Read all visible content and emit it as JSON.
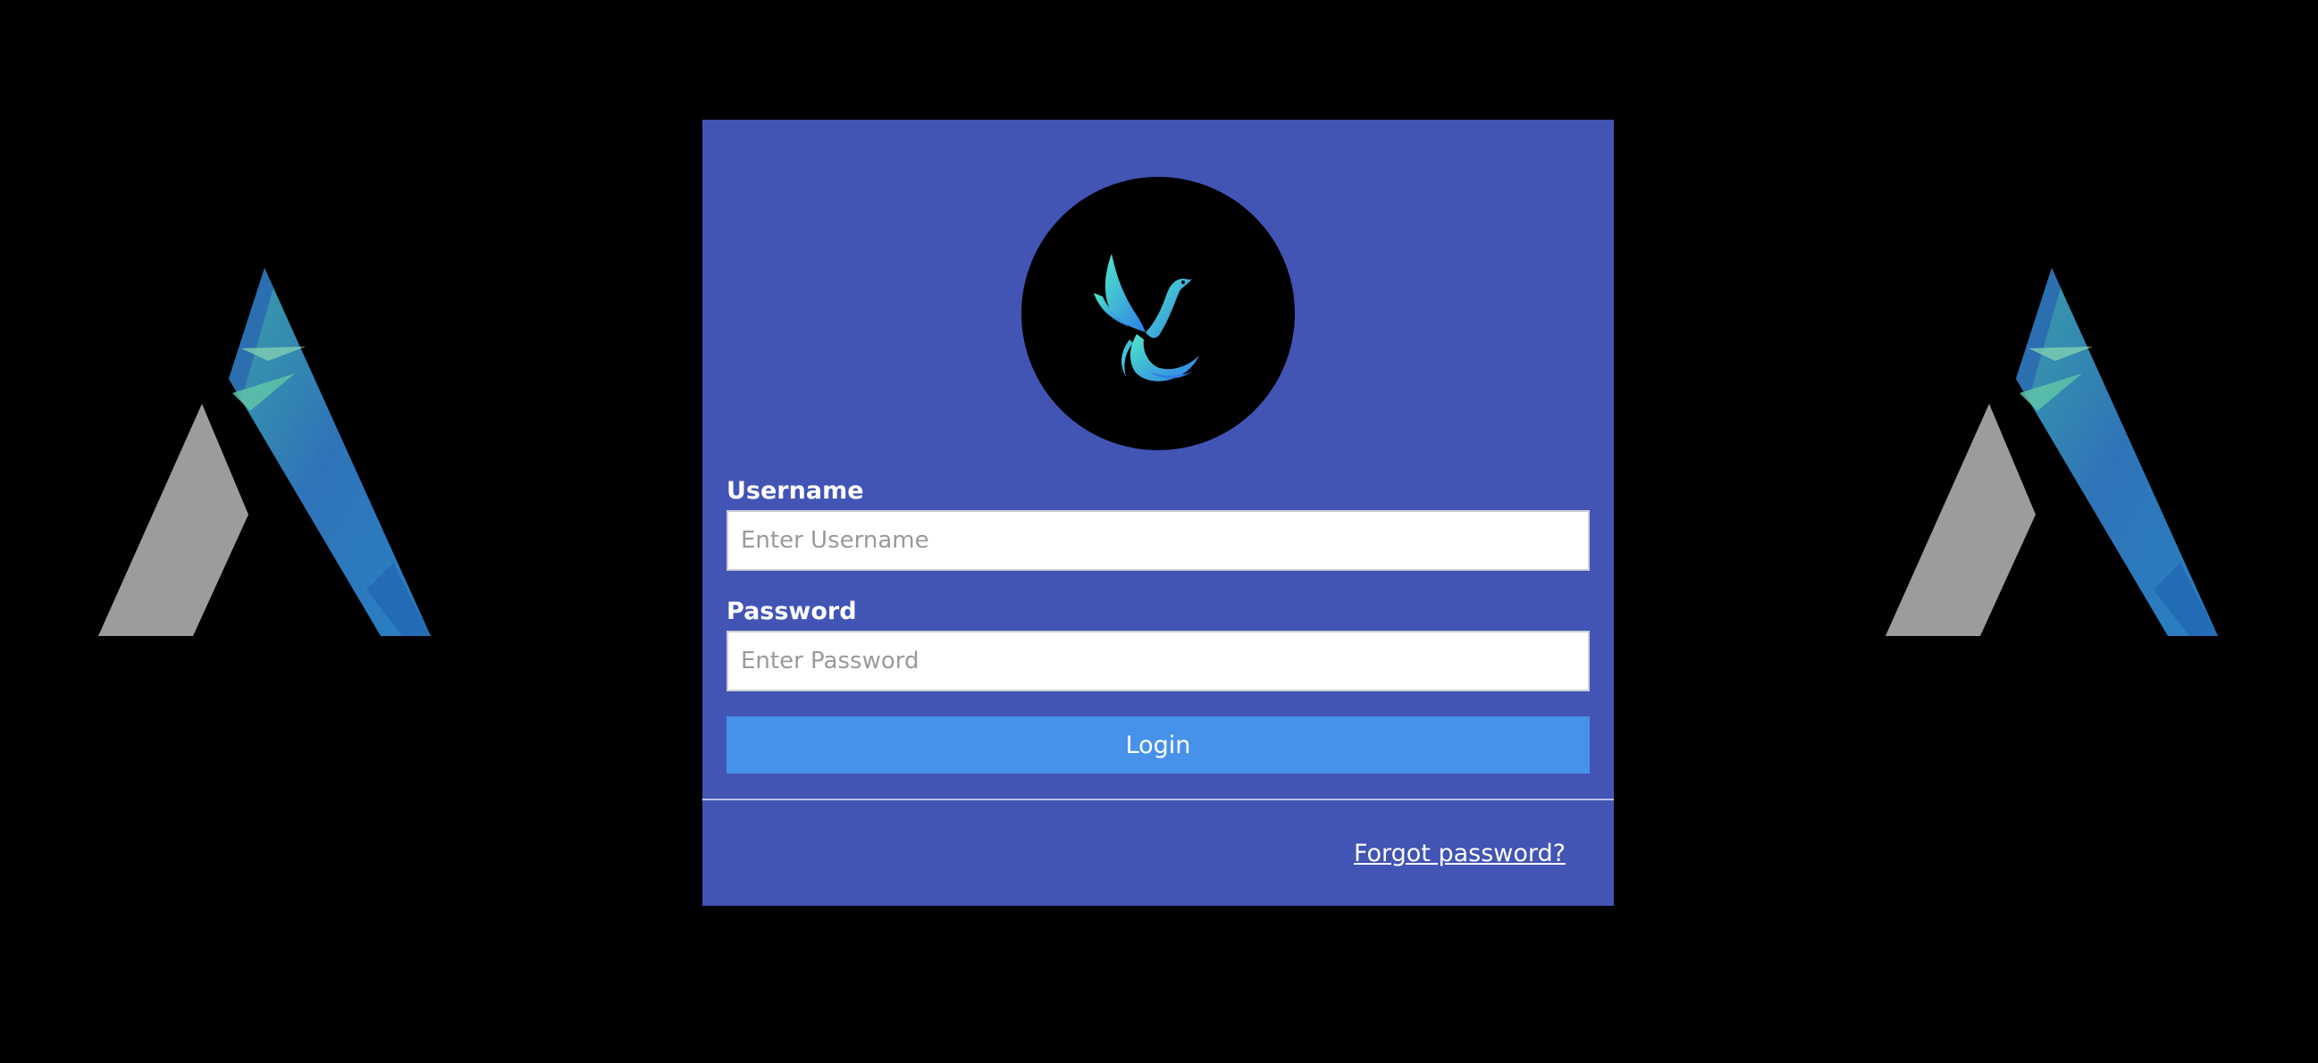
{
  "side_logos": {
    "left_icon": "stylized-a-logo-icon",
    "right_icon": "stylized-a-logo-icon"
  },
  "login_card": {
    "avatar_icon": "phoenix-bird-icon",
    "username": {
      "label": "Username",
      "placeholder": "Enter Username",
      "value": ""
    },
    "password": {
      "label": "Password",
      "placeholder": "Enter Password",
      "value": ""
    },
    "login_button": "Login",
    "forgot_password": "Forgot password?"
  },
  "colors": {
    "background": "#000000",
    "card": "#4254b4",
    "button": "#4692ea",
    "text": "#ffffff",
    "bird_gradient_start": "#4ee6c8",
    "bird_gradient_end": "#2f7de8"
  }
}
